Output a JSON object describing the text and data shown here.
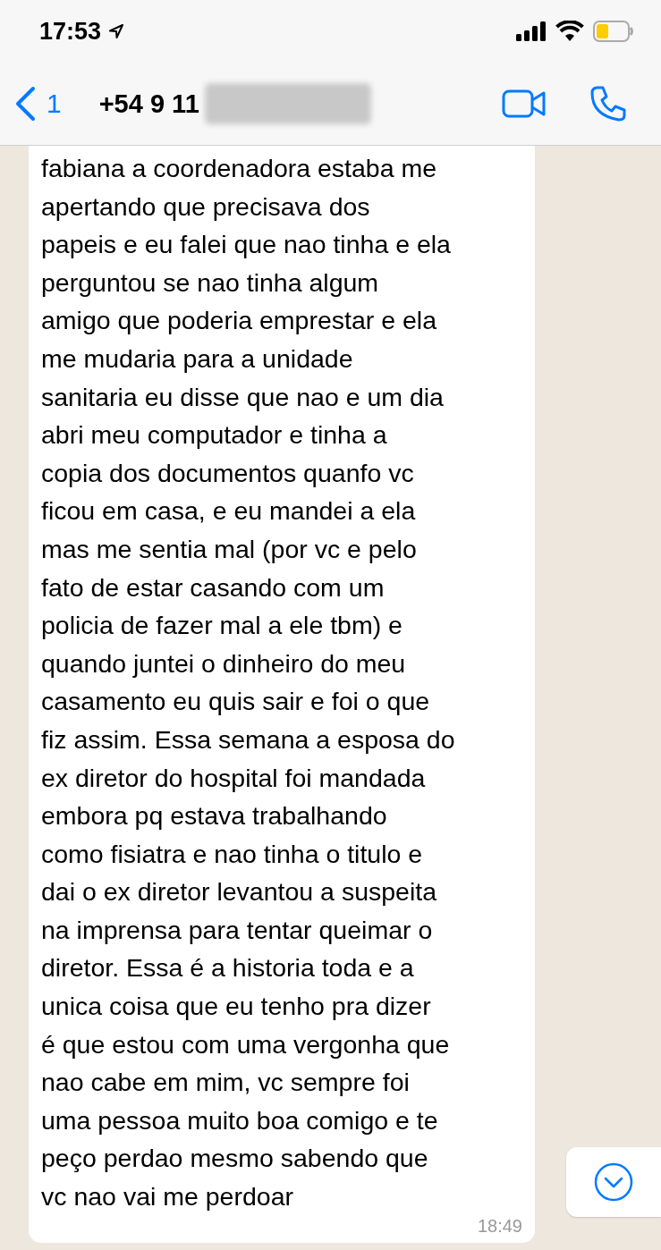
{
  "status_bar": {
    "time": "17:53"
  },
  "header": {
    "back_count": "1",
    "contact": "+54 9 11"
  },
  "message": {
    "text": "fabiana a coordenadora estaba me\napertando que precisava dos\npapeis e eu falei que nao tinha e ela\nperguntou se nao tinha algum\namigo que poderia emprestar e ela\nme mudaria para a unidade\nsanitaria eu disse que nao e um dia\nabri meu computador e tinha a\ncopia dos documentos quanfo vc\nficou em casa, e eu mandei a ela\nmas me sentia mal (por vc e pelo\nfato de estar casando com um\npolicia de fazer mal a ele tbm) e\nquando juntei o dinheiro do meu\ncasamento eu quis sair e foi o que\nfiz assim. Essa semana a esposa do\nex diretor do hospital foi mandada\nembora pq estava trabalhando\ncomo fisiatra e nao tinha o titulo e\ndai o ex diretor levantou a suspeita\nna imprensa para tentar queimar o\ndiretor. Essa é a historia toda e a\nunica coisa que eu tenho pra dizer\né que estou com uma vergonha que\nnao cabe em mim, vc sempre foi\numa pessoa muito boa comigo e te\npeço perdao mesmo sabendo que\nvc nao vai me perdoar",
    "time": "18:49"
  }
}
